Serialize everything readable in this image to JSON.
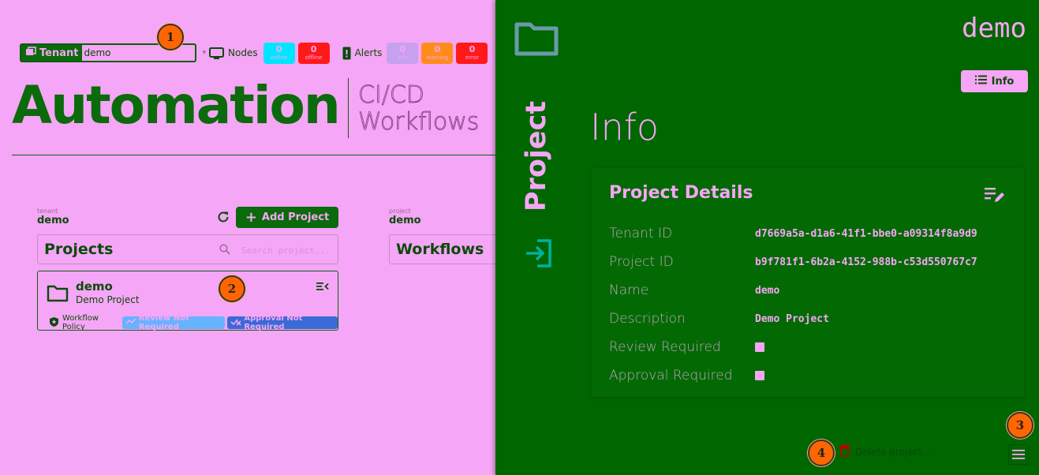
{
  "topbar": {
    "tenant_label": "Tenant",
    "tenant_value": "demo",
    "nodes_label": "Nodes",
    "nodes": [
      {
        "count": "0",
        "label": "online",
        "color": "#00e5ff"
      },
      {
        "count": "0",
        "label": "offline",
        "color": "#ff1a1a"
      }
    ],
    "alerts_label": "Alerts",
    "alerts": [
      {
        "count": "0",
        "label": "info",
        "color": "#c8a0f0"
      },
      {
        "count": "0",
        "label": "warning",
        "color": "#ff8c1a"
      },
      {
        "count": "0",
        "label": "error",
        "color": "#ff1a1a"
      }
    ]
  },
  "header": {
    "title": "Automation",
    "subtitle_line1": "CI/CD",
    "subtitle_line2": "Workflows"
  },
  "projects_panel": {
    "tenant_caption": "tenant",
    "tenant_value": "demo",
    "add_button_label": "Add Project",
    "panel_title": "Projects",
    "search_placeholder": "Search project..."
  },
  "project_card": {
    "name": "demo",
    "description": "Demo Project",
    "policy_label": "Workflow Policy",
    "review_chip": "Review Not Required",
    "approval_chip": "Approval Not Required",
    "review_chip_color": "#66b3ff",
    "approval_chip_color": "#3a6ad6"
  },
  "workflows_panel": {
    "project_caption": "project",
    "project_value": "demo",
    "panel_title": "Workflows"
  },
  "drawer": {
    "side_label": "Project",
    "title": "demo",
    "info_button_label": "Info",
    "heading": "Info",
    "card_title": "Project Details",
    "rows": [
      {
        "key": "Tenant ID",
        "value": "d7669a5a-d1a6-41f1-bbe0-a09314f8a9d9"
      },
      {
        "key": "Project ID",
        "value": "b9f781f1-6b2a-4152-988b-c53d550767c7"
      },
      {
        "key": "Name",
        "value": "demo"
      },
      {
        "key": "Description",
        "value": "Demo Project"
      },
      {
        "key": "Review Required",
        "value": ""
      },
      {
        "key": "Approval Required",
        "value": ""
      }
    ],
    "delete_label": "Delete project..."
  },
  "badges": [
    "1",
    "2",
    "3",
    "4"
  ],
  "colors": {
    "accent_green": "#0b6a0b",
    "drawer_green": "#006600",
    "pink_bg": "#f6a6f6",
    "badge_orange": "#ff6600"
  }
}
